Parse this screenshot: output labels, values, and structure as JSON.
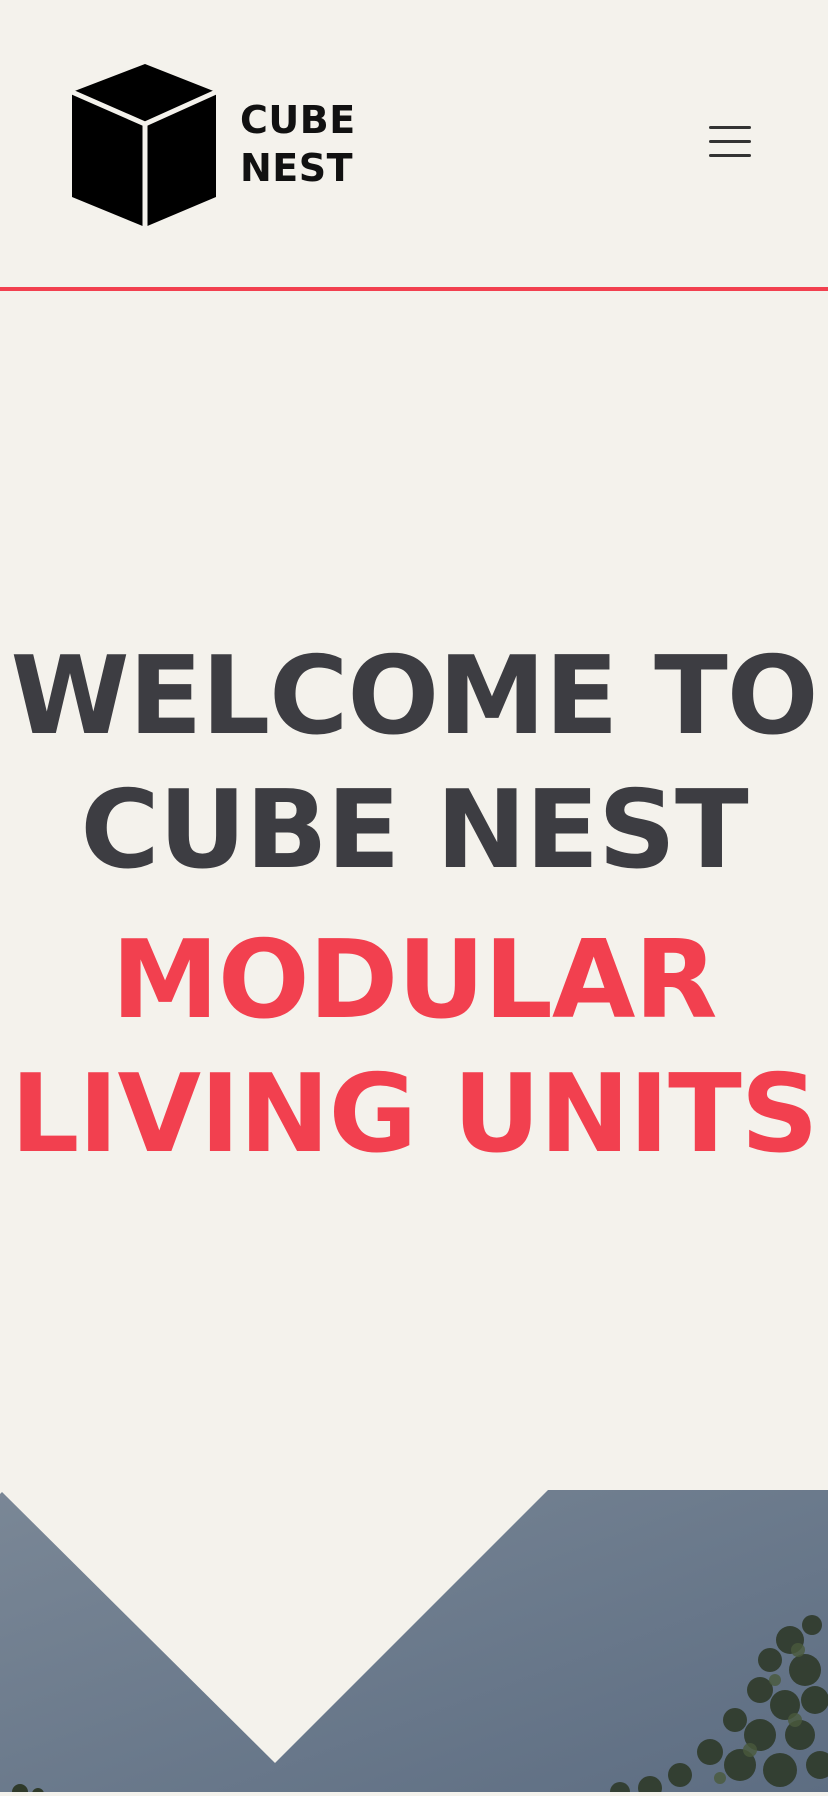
{
  "header": {
    "brand_line1": "CUBE",
    "brand_line2": "NEST",
    "logo_icon": "cube-icon",
    "menu_icon": "hamburger-menu-icon"
  },
  "hero": {
    "line1": "WELCOME TO",
    "line2": "CUBE NEST",
    "line3": "MODULAR",
    "line4": "LIVING UNITS"
  },
  "colors": {
    "background": "#f4f2ec",
    "accent": "#f2404f",
    "heading": "#3d3d42"
  }
}
